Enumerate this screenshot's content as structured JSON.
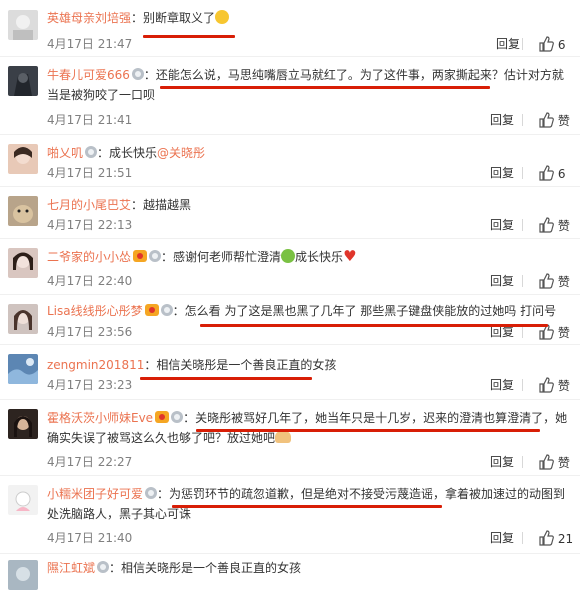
{
  "reply_label": "回复",
  "like_label": "赞",
  "comments": [
    {
      "user": "英雄母亲刘培强",
      "text": "别断章取义了",
      "time": "4月17日 21:47",
      "likes": "6"
    },
    {
      "user": "牛春儿可爱666",
      "text": "还能怎么说，马思纯嘴唇立马就红了。为了这件事，两家撕起来？估计对方就当是被狗咬了一口呗",
      "time": "4月17日 21:41",
      "likes": ""
    },
    {
      "user": "啪乂叽",
      "text_prefix": "成长快乐",
      "mention": "@关晓彤",
      "time": "4月17日 21:51",
      "likes": "6"
    },
    {
      "user": "七月的小尾巴艾",
      "text": "越描越黑",
      "time": "4月17日 22:13",
      "likes": ""
    },
    {
      "user": "二爷家的小小怂",
      "text": "感谢何老师帮忙澄清",
      "text_suffix": "成长快乐",
      "time": "4月17日 22:40",
      "likes": ""
    },
    {
      "user": "Lisa线线彤心彤梦",
      "text": "怎么看 为了这是黑也黑了几年了 那些黑子键盘侠能放的过她吗 打问号",
      "time": "4月17日 23:56",
      "likes": ""
    },
    {
      "user": "zengmin201811",
      "text": "相信关晓彤是一个善良正直的女孩",
      "time": "4月17日 23:23",
      "likes": ""
    },
    {
      "user": "霍格沃茨小师妹Eve",
      "text": "关晓彤被骂好几年了，她当年只是十几岁，迟来的澄清也算澄清了，她确实失误了被骂这么久也够了吧？放过她吧",
      "time": "4月17日 22:27",
      "likes": ""
    },
    {
      "user": "小糯米团子好可爱",
      "text": "为惩罚环节的疏忽道歉，但是绝对不接受污蔑造谣，拿着被加速过的动图到处洗脑路人，黑子其心可诛",
      "time": "4月17日 21:40",
      "likes": "21"
    },
    {
      "user": "隰江虹斌",
      "text": "相信关晓彤是一个善良正直的女孩",
      "time": "",
      "likes": ""
    }
  ]
}
